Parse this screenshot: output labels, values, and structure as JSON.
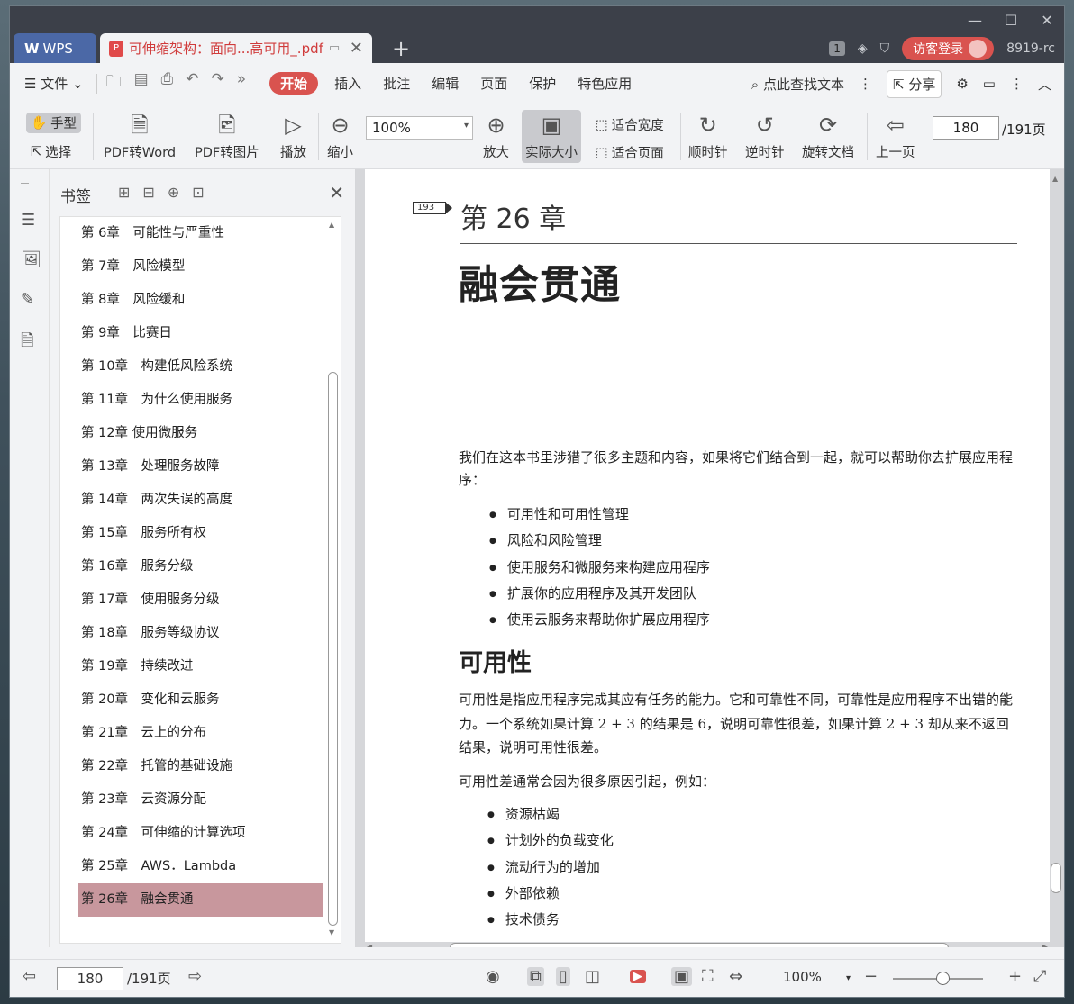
{
  "window": {
    "controls": [
      "—",
      "☐",
      "✕"
    ]
  },
  "tabs": {
    "app": "WPS",
    "doc": "可伸缩架构：面向...高可用_.pdf",
    "add": "+"
  },
  "titlebar_right": {
    "badge": "1",
    "login": "访客登录",
    "version": "8919-rc"
  },
  "menubar": {
    "file": "文件",
    "items": [
      "开始",
      "插入",
      "批注",
      "编辑",
      "页面",
      "保护",
      "特色应用"
    ],
    "search": "点此查找文本",
    "share": "分享"
  },
  "toolbar": {
    "hand": "手型",
    "select": "选择",
    "pdf_to_word": "PDF转Word",
    "pdf_to_image": "PDF转图片",
    "play": "播放",
    "zoom_out": "缩小",
    "zoom_value": "100%",
    "zoom_in": "放大",
    "actual_size": "实际大小",
    "fit_width": "适合宽度",
    "fit_page": "适合页面",
    "clockwise": "顺时针",
    "counterclockwise": "逆时针",
    "rotate_doc": "旋转文档",
    "prev_page": "上一页",
    "page_current": "180",
    "page_total": "/191页"
  },
  "bookmarks": {
    "title": "书签",
    "items": [
      "第 6章　可能性与严重性",
      "第 7章　风险模型",
      "第 8章　风险缓和",
      "第 9章　比赛日",
      "第 10章　构建低风险系统",
      "第 11章　为什么使用服务",
      "第 12章  使用微服务",
      "第 13章　处理服务故障",
      "第 14章　两次失误的高度",
      "第 15章　服务所有权",
      "第 16章　服务分级",
      "第 17章　使用服务分级",
      "第 18章　服务等级协议",
      "第 19章　持续改进",
      "第 20章　变化和云服务",
      "第 21章　云上的分布",
      "第 22章　托管的基础设施",
      "第 23章　云资源分配",
      "第 24章　可伸缩的计算选项",
      "第 25章　AWS．Lambda",
      "第 26章　融会贯通"
    ],
    "selected_index": 20
  },
  "page": {
    "tag": "193",
    "chapter": "第 26 章",
    "title": "融会贯通",
    "intro": "我们在这本书里涉猎了很多主题和内容，如果将它们结合到一起，就可以帮助你去扩展应用程序：",
    "list1": [
      "可用性和可用性管理",
      "风险和风险管理",
      "使用服务和微服务来构建应用程序",
      "扩展你的应用程序及其开发团队",
      "使用云服务来帮助你扩展应用程序"
    ],
    "section": "可用性",
    "para1": "可用性是指应用程序完成其应有任务的能力。它和可靠性不同，可靠性是应用程序不出错的能力。一个系统如果计算 2 + 3 的结果是 6，说明可靠性很差，如果计算 2 + 3 却从来不返回结果，说明可用性很差。",
    "para2": "可用性差通常会因为很多原因引起，例如：",
    "list2": [
      "资源枯竭",
      "计划外的负载变化",
      "流动行为的增加",
      "外部依赖",
      "技术债务"
    ]
  },
  "statusbar": {
    "page_current": "180",
    "page_total": "/191页",
    "zoom": "100%"
  }
}
